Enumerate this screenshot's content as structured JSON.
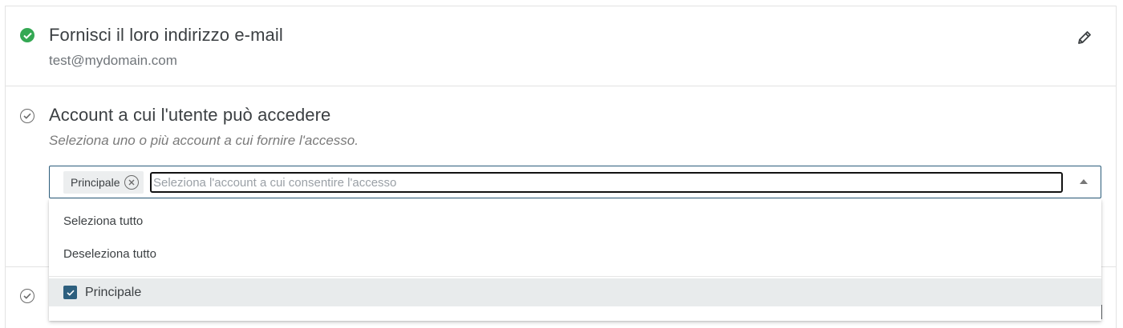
{
  "steps": [
    {
      "title": "Fornisci il loro indirizzo e-mail",
      "subtitle": "test@mydomain.com",
      "status": "done",
      "status_icon": "check-circle-filled-icon",
      "edit_icon": "pencil-icon"
    },
    {
      "title": "Account a cui l'utente può accedere",
      "hint": "Seleziona uno o più account a cui fornire l'accesso.",
      "status": "pending",
      "status_icon": "check-circle-outline-icon"
    },
    {
      "status": "pending",
      "status_icon": "check-circle-outline-icon"
    }
  ],
  "account_select": {
    "chips": [
      {
        "label": "Principale"
      }
    ],
    "search_placeholder": "Seleziona l'account a cui consentire l'accesso",
    "search_value": ""
  },
  "dropdown": {
    "select_all_label": "Seleziona tutto",
    "deselect_all_label": "Deseleziona tutto",
    "options": [
      {
        "label": "Principale",
        "checked": true
      }
    ]
  },
  "colors": {
    "done_green": "#34a853",
    "accent_blue": "#2d5f7e",
    "border": "#e3e3e3"
  }
}
